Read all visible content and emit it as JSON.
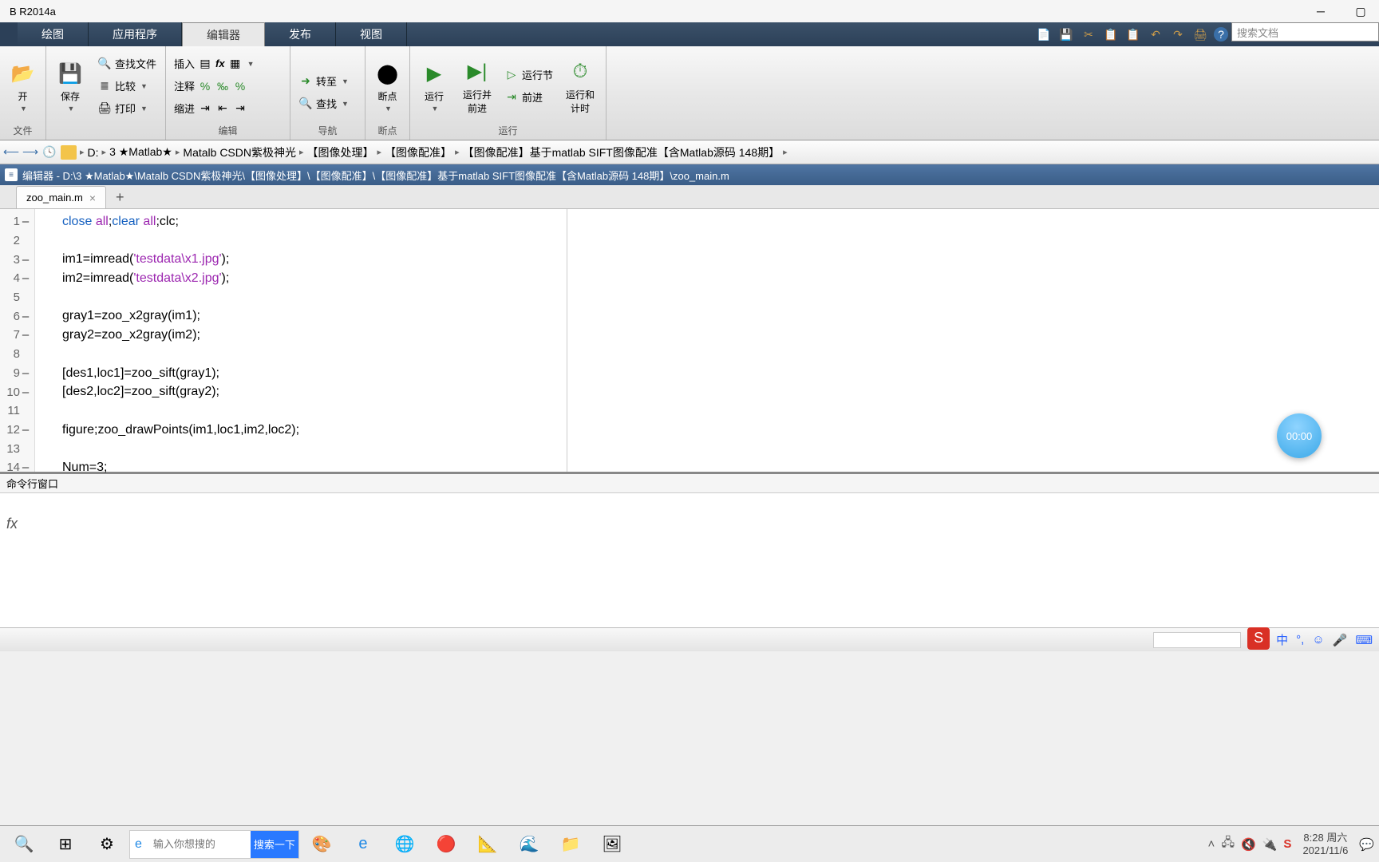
{
  "window": {
    "title": "B R2014a"
  },
  "tabs": {
    "plot": "绘图",
    "apps": "应用程序",
    "editor": "编辑器",
    "publish": "发布",
    "view": "视图"
  },
  "search_placeholder": "搜索文档",
  "ribbon": {
    "file": {
      "label": "文件",
      "open": "开",
      "save": "保存",
      "find_files": "查找文件",
      "compare": "比较",
      "print": "打印"
    },
    "edit": {
      "label": "编辑",
      "insert": "插入",
      "comment": "注释",
      "indent": "缩进"
    },
    "nav": {
      "label": "导航",
      "goto": "转至",
      "find": "查找"
    },
    "breakpoints": {
      "label": "断点",
      "btn": "断点"
    },
    "run": {
      "label": "运行",
      "run": "运行",
      "run_advance": "运行并\n前进",
      "run_section": "运行节",
      "advance": "前进",
      "run_time": "运行和\n计时"
    }
  },
  "breadcrumb": [
    "D:",
    "3 ★Matlab★",
    "Matalb CSDN紫极神光",
    "【图像处理】",
    "【图像配准】",
    "【图像配准】基于matlab SIFT图像配准【含Matlab源码 148期】"
  ],
  "editor_title": "编辑器 - D:\\3 ★Matlab★\\Matalb CSDN紫极神光\\【图像处理】\\【图像配准】\\【图像配准】基于matlab SIFT图像配准【含Matlab源码 148期】\\zoo_main.m",
  "file_tab": "zoo_main.m",
  "code": {
    "lines": [
      {
        "n": 1,
        "dash": true,
        "html": "<span class='kw'>close</span> <span class='str'>all</span>;<span class='kw'>clear</span> <span class='str'>all</span>;clc;"
      },
      {
        "n": 2,
        "dash": false,
        "html": ""
      },
      {
        "n": 3,
        "dash": true,
        "html": "im1=imread(<span class='str'>'testdata\\x1.jpg'</span>);"
      },
      {
        "n": 4,
        "dash": true,
        "html": "im2=imread(<span class='str'>'testdata\\x2.jpg'</span>);"
      },
      {
        "n": 5,
        "dash": false,
        "html": ""
      },
      {
        "n": 6,
        "dash": true,
        "html": "gray1=zoo_x2gray(im1);"
      },
      {
        "n": 7,
        "dash": true,
        "html": "gray2=zoo_x2gray(im2);"
      },
      {
        "n": 8,
        "dash": false,
        "html": ""
      },
      {
        "n": 9,
        "dash": true,
        "html": "[des1,loc1]=zoo_sift(gray1);"
      },
      {
        "n": 10,
        "dash": true,
        "html": "[des2,loc2]=zoo_sift(gray2);"
      },
      {
        "n": 11,
        "dash": false,
        "html": ""
      },
      {
        "n": 12,
        "dash": true,
        "html": "figure;zoo_drawPoints(im1,loc1,im2,loc2);"
      },
      {
        "n": 13,
        "dash": false,
        "html": ""
      },
      {
        "n": 14,
        "dash": true,
        "html": "Num=3;"
      }
    ]
  },
  "timer": "00:00",
  "cmd_title": "命令行窗口",
  "cmd_prompt": "fx",
  "ime": {
    "badge": "S",
    "lang": "中"
  },
  "task_search_placeholder": "输入你想搜的",
  "task_search_btn": "搜索一下",
  "clock": {
    "time": "8:28 周六",
    "date": "2021/11/6"
  }
}
